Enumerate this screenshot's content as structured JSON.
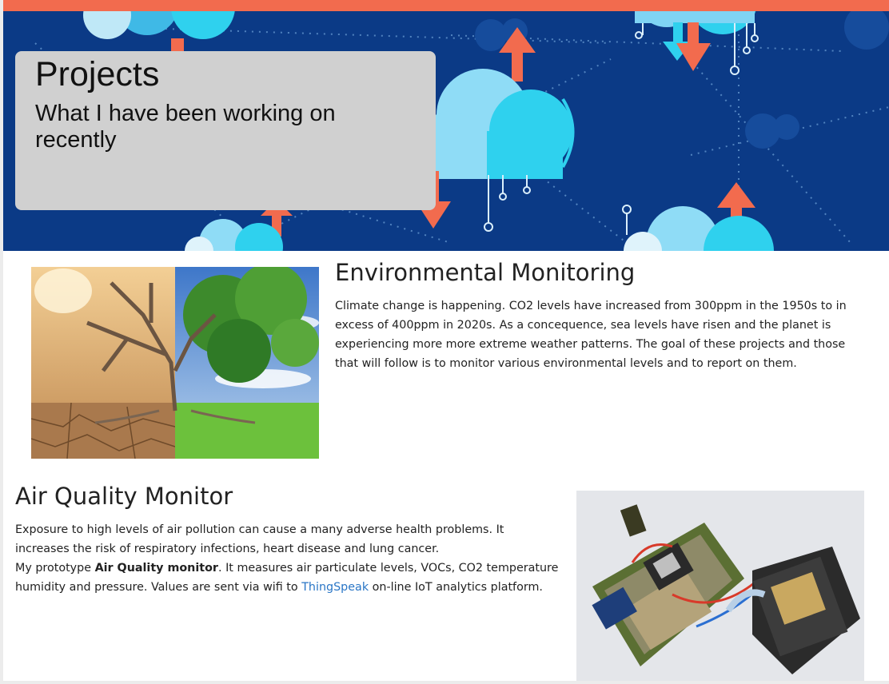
{
  "hero": {
    "title": "Projects",
    "subtitle": "What I have been working on recently"
  },
  "env": {
    "heading": "Environmental Monitoring",
    "body": "Climate change is happening. CO2 levels have increased from 300ppm in the 1950s to in excess of 400ppm in 2020s. As a concequence, sea levels have risen and the planet is experiencing more more extreme weather patterns. The goal of these projects and those that will follow is to monitor various environmental levels and to report on them."
  },
  "aq": {
    "heading": "Air Quality Monitor",
    "line1": "Exposure to high levels of air pollution can cause a many adverse health problems. It increases the risk of respiratory infections, heart disease and lung cancer.",
    "line2_prefix": "My prototype ",
    "line2_bold": "Air Quality monitor",
    "line2_middle": ". It measures air particulate levels, VOCs, CO2 temperature humidity and pressure. Values are sent via wifi to ",
    "line2_link": "ThingSpeak",
    "line2_suffix": " on-line IoT analytics platform."
  },
  "colors": {
    "accent_bar": "#f26b4e",
    "hero_background": "#0b3a86",
    "card_background": "#d0d0d0",
    "link": "#2a76c6"
  }
}
